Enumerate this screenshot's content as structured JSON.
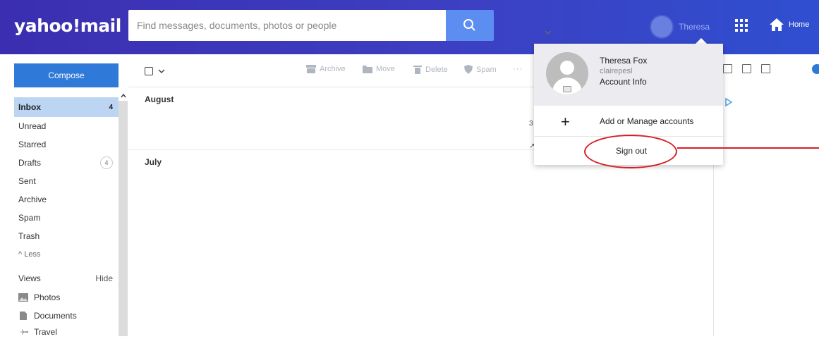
{
  "header": {
    "logo": "yahoo!mail",
    "search_placeholder": "Find messages, documents, photos or people",
    "profile_name": "Theresa",
    "home_label": "Home"
  },
  "sidebar": {
    "compose_label": "Compose",
    "folders": [
      {
        "label": "Inbox",
        "count": "4"
      },
      {
        "label": "Unread",
        "count": ""
      },
      {
        "label": "Starred",
        "count": ""
      },
      {
        "label": "Drafts",
        "count": "4"
      },
      {
        "label": "Sent",
        "count": ""
      },
      {
        "label": "Archive",
        "count": ""
      },
      {
        "label": "Spam",
        "count": ""
      },
      {
        "label": "Trash",
        "count": ""
      },
      {
        "label": "^ Less",
        "count": ""
      }
    ],
    "views_label": "Views",
    "hide_label": "Hide",
    "views": [
      "Photos",
      "Documents",
      "Travel"
    ]
  },
  "toolbar": {
    "archive": "Archive",
    "move": "Move",
    "delete": "Delete",
    "spam": "Spam",
    "more": "···"
  },
  "messages": {
    "groups": [
      "August",
      "July"
    ],
    "partial_chars": [
      "3",
      "↗"
    ]
  },
  "account_menu": {
    "name": "Theresa Fox",
    "username": "clairepesl",
    "account_info": "Account Info",
    "add_manage": "Add or Manage accounts",
    "sign_out": "Sign out"
  },
  "colors": {
    "header_bg": "#3b2eb0",
    "compose_bg": "#2f79d8",
    "active_folder_bg": "#bcd5f3",
    "highlight": "#d61f26"
  }
}
